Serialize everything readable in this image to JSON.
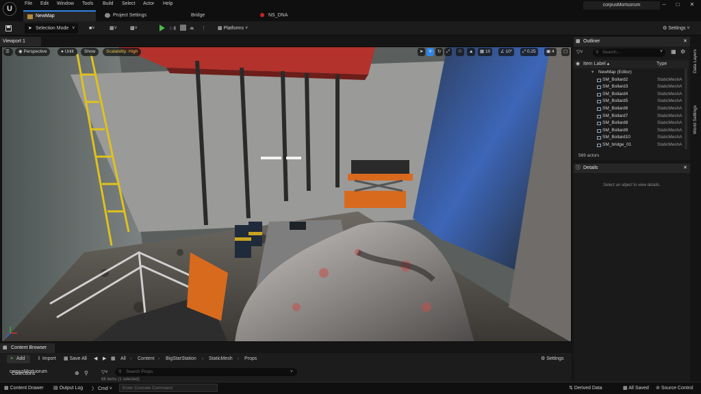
{
  "menubar": {
    "items": [
      "File",
      "Edit",
      "Window",
      "Tools",
      "Build",
      "Select",
      "Actor",
      "Help"
    ],
    "project_name": "corpusMortuorum"
  },
  "tabs": [
    {
      "label": "NewMap",
      "active": true
    },
    {
      "label": "Project Settings",
      "active": false
    },
    {
      "label": "Bridge",
      "active": false
    },
    {
      "label": "NS_DNA",
      "active": false
    }
  ],
  "toolbar": {
    "selection_mode": "Selection Mode",
    "platforms": "Platforms",
    "settings": "Settings"
  },
  "viewport": {
    "tab_label": "Viewport 1",
    "perspective": "Perspective",
    "unlit": "Unlit",
    "show": "Show",
    "scalability": "Scalability: High",
    "grid_snap": "10",
    "rotation_snap": "10°",
    "scale_snap": "0.25",
    "camera_speed": "4"
  },
  "outliner": {
    "title": "Outliner",
    "search_placeholder": "Search...",
    "col_label": "Item Label",
    "col_type": "Type",
    "root": "NewMap (Editor)",
    "rows": [
      {
        "name": "SM_Bollard2",
        "type": "StaticMeshA"
      },
      {
        "name": "SM_Bollard3",
        "type": "StaticMeshA"
      },
      {
        "name": "SM_Bollard4",
        "type": "StaticMeshA"
      },
      {
        "name": "SM_Bollard5",
        "type": "StaticMeshA"
      },
      {
        "name": "SM_Bollard6",
        "type": "StaticMeshA"
      },
      {
        "name": "SM_Bollard7",
        "type": "StaticMeshA"
      },
      {
        "name": "SM_Bollard8",
        "type": "StaticMeshA"
      },
      {
        "name": "SM_Bollard9",
        "type": "StaticMeshA"
      },
      {
        "name": "SM_Bollard10",
        "type": "StaticMeshA"
      },
      {
        "name": "SM_bridge_01",
        "type": "StaticMeshA"
      }
    ],
    "actor_count": "569 actors"
  },
  "details": {
    "title": "Details",
    "empty_text": "Select an object to view details."
  },
  "side_tabs": {
    "data_layers": "Data Layers",
    "world_settings": "World Settings"
  },
  "content_browser": {
    "tab_label": "Content Browser",
    "add": "Add",
    "import": "Import",
    "save_all": "Save All",
    "breadcrumbs": [
      "All",
      "Content",
      "BigStarStation",
      "StaticMesh",
      "Props"
    ],
    "settings": "Settings",
    "sources_label": "corpusMortuorum",
    "collections_label": "Collections",
    "search_placeholder": "Search Props",
    "item_count": "68 items (1 selected)"
  },
  "statusbar": {
    "content_drawer": "Content Drawer",
    "output_log": "Output Log",
    "cmd": "Cmd",
    "console_placeholder": "Enter Console Command",
    "derived_data": "Derived Data",
    "all_saved": "All Saved",
    "source_control": "Source Control"
  },
  "colors": {
    "accent": "#2f86e8",
    "play": "#4cb84c",
    "scalability": "#e8c04a",
    "add_button": "#4cb84c"
  },
  "icons": [
    "unreal-logo-icon",
    "save-icon",
    "play-icon",
    "stop-icon",
    "search-icon",
    "gear-icon",
    "eye-icon",
    "folder-icon",
    "close-icon"
  ]
}
